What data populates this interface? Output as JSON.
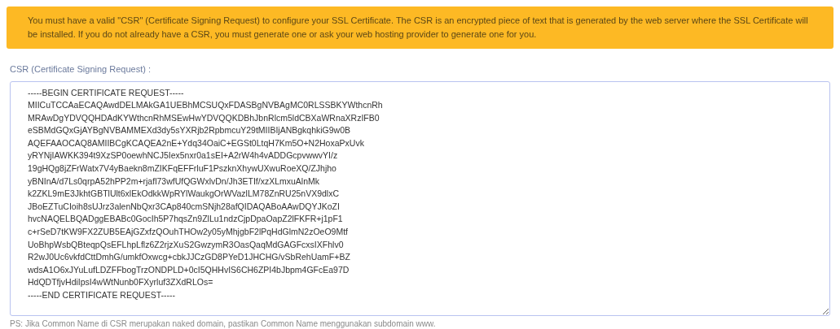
{
  "notice": "You must have a valid \"CSR\" (Certificate Signing Request) to configure your SSL Certificate. The CSR is an encrypted piece of text that is generated by the web server where the SSL Certificate will be installed. If you do not already have a CSR, you must generate one or ask your web hosting provider to generate one for you.",
  "csr_field": {
    "label": "CSR (Certificate Signing Request) :",
    "value": "-----BEGIN CERTIFICATE REQUEST-----\nMIICuTCCAaECAQAwdDELMAkGA1UEBhMCSUQxFDASBgNVBAgMC0RLSSBKYWthcnRh\nMRAwDgYDVQQHDAdKYWthcnRhMSEwHwYDVQQKDBhJbnRlcm5ldCBXaWRnaXRzIFB0\neSBMdGQxGjAYBgNVBAMMEXd3dy5sYXRjb2RpbmcuY29tMIIBIjANBgkqhkiG9w0B\nAQEFAAOCAQ8AMIIBCgKCAQEA2nE+Ydq34OaiC+EGSt0LtqH7Km5O+N2HoxaPxUvk\nyRYNjIAWKK394t9XzSP0oewhNCJ5Iex5nxr0a1sEI+A2rW4h4vADDGcpvwwvYI/z\n19gHQg8jZFrWatx7V4yBaekn8mZIKFqEFFrluF1PszknXhywUXwuRoeXQ/ZJhjho\nyBNInA/d7Ls0qrpA52hPP2m+rjafl73wfUfQGWxlvDn/Jh3ETIf/xzXLmxuAlnMk\nk2ZKL9mE3JkhtGBTlUlt6xlEkOdkkWpRYlWaukgOrWVazlLM78ZnRU25nVX9dlxC\nJBoEZTuCIoih8sUJrz3alenNbQxr3CAp840cmSNjh28afQIDAQABoAAwDQYJKoZI\nhvcNAQELBQADggEBABc0GocIh5P7hqsZn9ZlLu1ndzCjpDpaOapZ2lFKFR+j1pF1\nc+rSeD7tKW9FX2ZUB5EAjGZxfzQOuhTHOw2y05yMhjgbF2lPqHdGlmN2zOeO9Mtf\nUoBhpWsbQBteqpQsEFLhpLflz6Z2rjzXuS2GwzymR3OasQaqMdGAGFcxsIXFhlv0\nR2wJ0Uc6vkfdCttDmhG/umkfOxwcg+cbkJJCzGD8PYeD1JHCHG/vSbRehUamF+BZ\nwdsA1O6xJYuLufLDZFFbogTrzONDPLD+0cI5QHHvIS6CH6ZPI4bJbpm4GFcEa97D\nHdQDTfjvHdiIpsI4wWtNunb0FXyrluf3ZXdRLOs=\n-----END CERTIFICATE REQUEST-----"
  },
  "hint": "PS: Jika Common Name di CSR merupakan naked domain, pastikan Common Name menggunakan subdomain www."
}
